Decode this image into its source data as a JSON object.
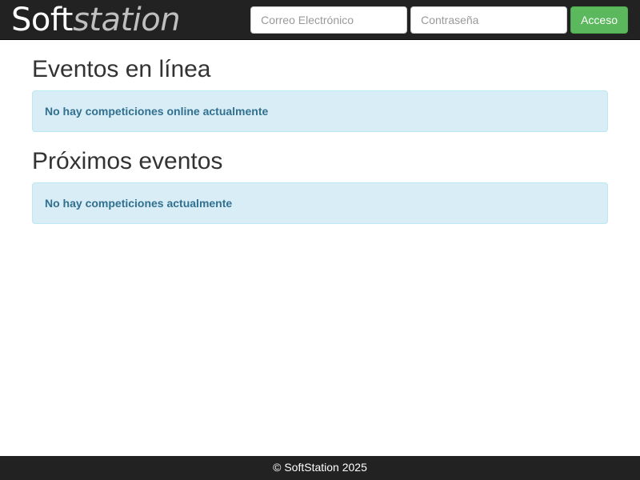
{
  "navbar": {
    "brand_part1": "Soft",
    "brand_part2": "station",
    "email_placeholder": "Correo Electrónico",
    "password_placeholder": "Contraseña",
    "login_label": "Acceso"
  },
  "main": {
    "sections": [
      {
        "title": "Eventos en línea",
        "message": "No hay competiciones online actualmente"
      },
      {
        "title": "Próximos eventos",
        "message": "No hay competiciones actualmente"
      }
    ]
  },
  "footer": {
    "text": "© SoftStation 2025"
  },
  "colors": {
    "navbar_bg": "#222222",
    "login_button": "#5cb85c",
    "alert_bg": "#d9edf7",
    "alert_text": "#31708f"
  }
}
